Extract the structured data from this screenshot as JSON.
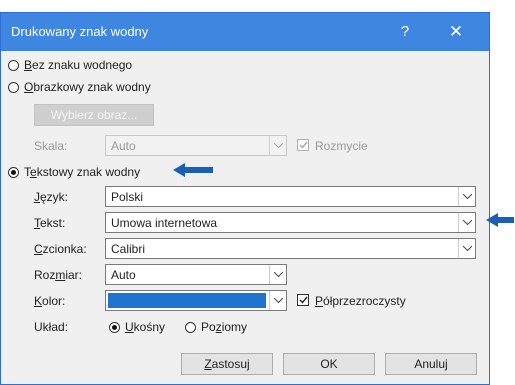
{
  "title": "Drukowany znak wodny",
  "titlebar": {
    "help": "?",
    "close": "✕"
  },
  "options": {
    "none": {
      "prefix": "",
      "key": "B",
      "rest": "ez znaku wodnego"
    },
    "picture": {
      "prefix": "",
      "key": "O",
      "rest": "brazkowy znak wodny"
    },
    "text": {
      "prefix": "T",
      "key": "e",
      "rest": "kstowy znak wodny"
    }
  },
  "picture_section": {
    "select_button": "Wybierz obraz...",
    "scale_label": "Skala:",
    "scale_value": "Auto",
    "washout_label": "Rozmycie"
  },
  "text_section": {
    "language": {
      "key": "J",
      "rest": "ęzyk:",
      "value": "Polski"
    },
    "text": {
      "key": "T",
      "rest": "ekst:",
      "value": "Umowa internetowa"
    },
    "font": {
      "key": "C",
      "rest": "zcionka:",
      "value": "Calibri"
    },
    "size": {
      "prefix": "Roz",
      "key": "m",
      "rest": "iar:",
      "value": "Auto"
    },
    "color": {
      "key": "K",
      "rest": "olor:",
      "value_color": "#1f74d0"
    },
    "semitransparent": {
      "key": "P",
      "rest": "ółprzezroczysty"
    },
    "layout_label": "Układ:",
    "layout": {
      "diagonal": {
        "key": "U",
        "rest": "kośny"
      },
      "horizontal": {
        "prefix": "Po",
        "key": "z",
        "rest": "iomy"
      }
    }
  },
  "buttons": {
    "apply": {
      "key": "Z",
      "rest": "astosuj"
    },
    "ok": "OK",
    "cancel": "Anuluj"
  },
  "colors": {
    "titlebar": "#3f86e0",
    "annotation_arrow": "#1a5fb4"
  }
}
